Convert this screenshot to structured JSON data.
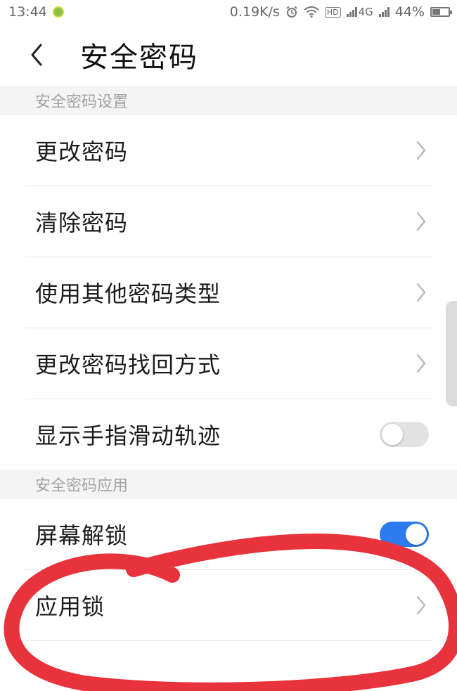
{
  "status_bar": {
    "time": "13:44",
    "net_speed": "0.19K/s",
    "network": "4G",
    "battery": "44%",
    "hd": "HD"
  },
  "header": {
    "back_icon": "chevron-left-icon",
    "title": "安全密码"
  },
  "sections": {
    "settings_title": "安全密码设置",
    "apps_title": "安全密码应用"
  },
  "items": [
    {
      "label": "更改密码",
      "control": "chevron"
    },
    {
      "label": "清除密码",
      "control": "chevron"
    },
    {
      "label": "使用其他密码类型",
      "control": "chevron"
    },
    {
      "label": "更改密码找回方式",
      "control": "chevron"
    },
    {
      "label": "显示手指滑动轨迹",
      "control": "toggle",
      "toggle_on": false
    }
  ],
  "app_items": [
    {
      "label": "屏幕解锁",
      "control": "toggle",
      "toggle_on": true
    },
    {
      "label": "应用锁",
      "control": "chevron"
    }
  ],
  "colors": {
    "accent": "#2e7bf0",
    "annotation": "#e8323c",
    "section_bg": "#f4f4f4"
  }
}
